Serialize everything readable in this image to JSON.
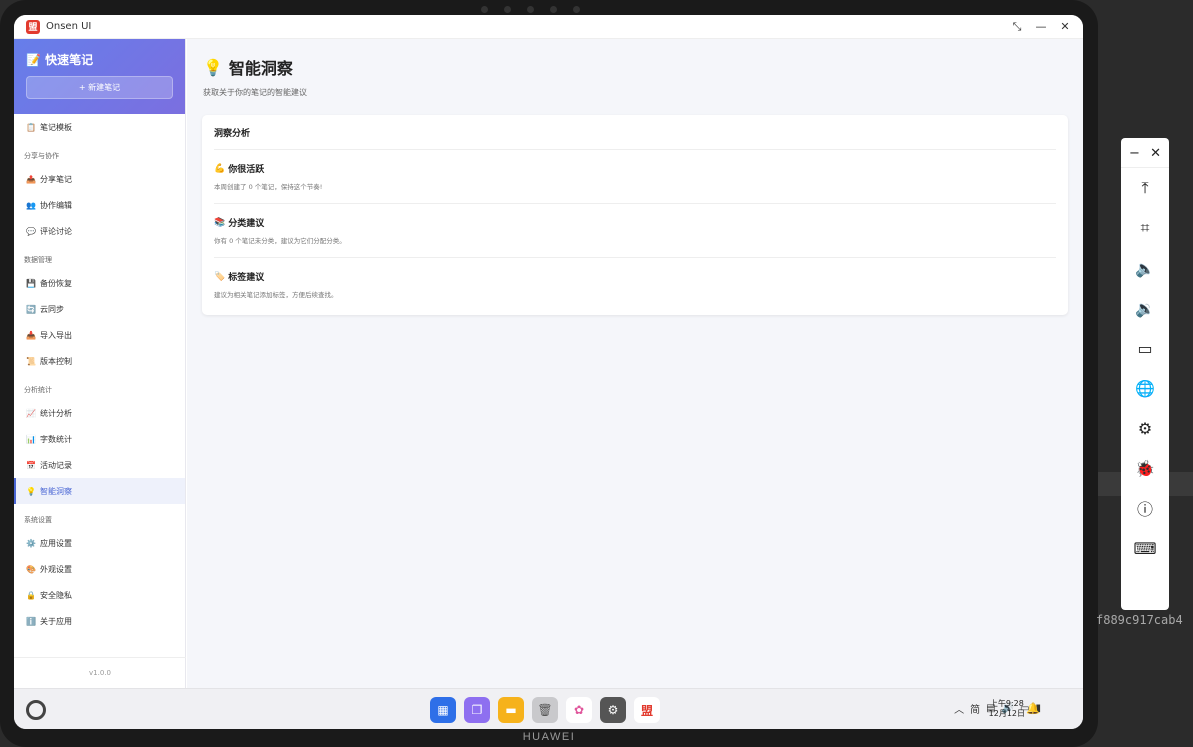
{
  "window": {
    "title": "Onsen UI",
    "logo_text": "盟"
  },
  "sidebar": {
    "app_name": "📝 快速笔记",
    "new_note_label": "+ 新建笔记",
    "items_top": [
      {
        "icon": "📋",
        "label": "笔记模板"
      }
    ],
    "sections": [
      {
        "title": "分享与协作",
        "items": [
          {
            "icon": "📤",
            "label": "分享笔记"
          },
          {
            "icon": "👥",
            "label": "协作编辑"
          },
          {
            "icon": "💬",
            "label": "评论讨论"
          }
        ]
      },
      {
        "title": "数据管理",
        "items": [
          {
            "icon": "💾",
            "label": "备份恢复"
          },
          {
            "icon": "🔄",
            "label": "云同步"
          },
          {
            "icon": "📥",
            "label": "导入导出"
          },
          {
            "icon": "📜",
            "label": "版本控制"
          }
        ]
      },
      {
        "title": "分析统计",
        "items": [
          {
            "icon": "📈",
            "label": "统计分析"
          },
          {
            "icon": "📊",
            "label": "字数统计"
          },
          {
            "icon": "📅",
            "label": "活动记录"
          },
          {
            "icon": "💡",
            "label": "智能洞察"
          }
        ]
      },
      {
        "title": "系统设置",
        "items": [
          {
            "icon": "⚙️",
            "label": "应用设置"
          },
          {
            "icon": "🎨",
            "label": "外观设置"
          },
          {
            "icon": "🔒",
            "label": "安全隐私"
          },
          {
            "icon": "ℹ️",
            "label": "关于应用"
          }
        ]
      }
    ],
    "version": "v1.0.0"
  },
  "main": {
    "title_icon": "💡",
    "title": "智能洞察",
    "subtitle": "获取关于你的笔记的智能建议",
    "card_title": "洞察分析",
    "insights": [
      {
        "icon": "💪",
        "title": "你很活跃",
        "desc": "本周创建了 0 个笔记，保持这个节奏!"
      },
      {
        "icon": "📚",
        "title": "分类建议",
        "desc": "你有 0 个笔记未分类，建议为它们分配分类。"
      },
      {
        "icon": "🏷️",
        "title": "标签建议",
        "desc": "建议为相关笔记添加标签，方便后续查找。"
      }
    ]
  },
  "taskbar": {
    "time": "上午9:28",
    "date": "12月12日",
    "tray_ime": "简"
  },
  "device": {
    "brand": "HUAWEI"
  },
  "side_label": "f889c917cab4"
}
